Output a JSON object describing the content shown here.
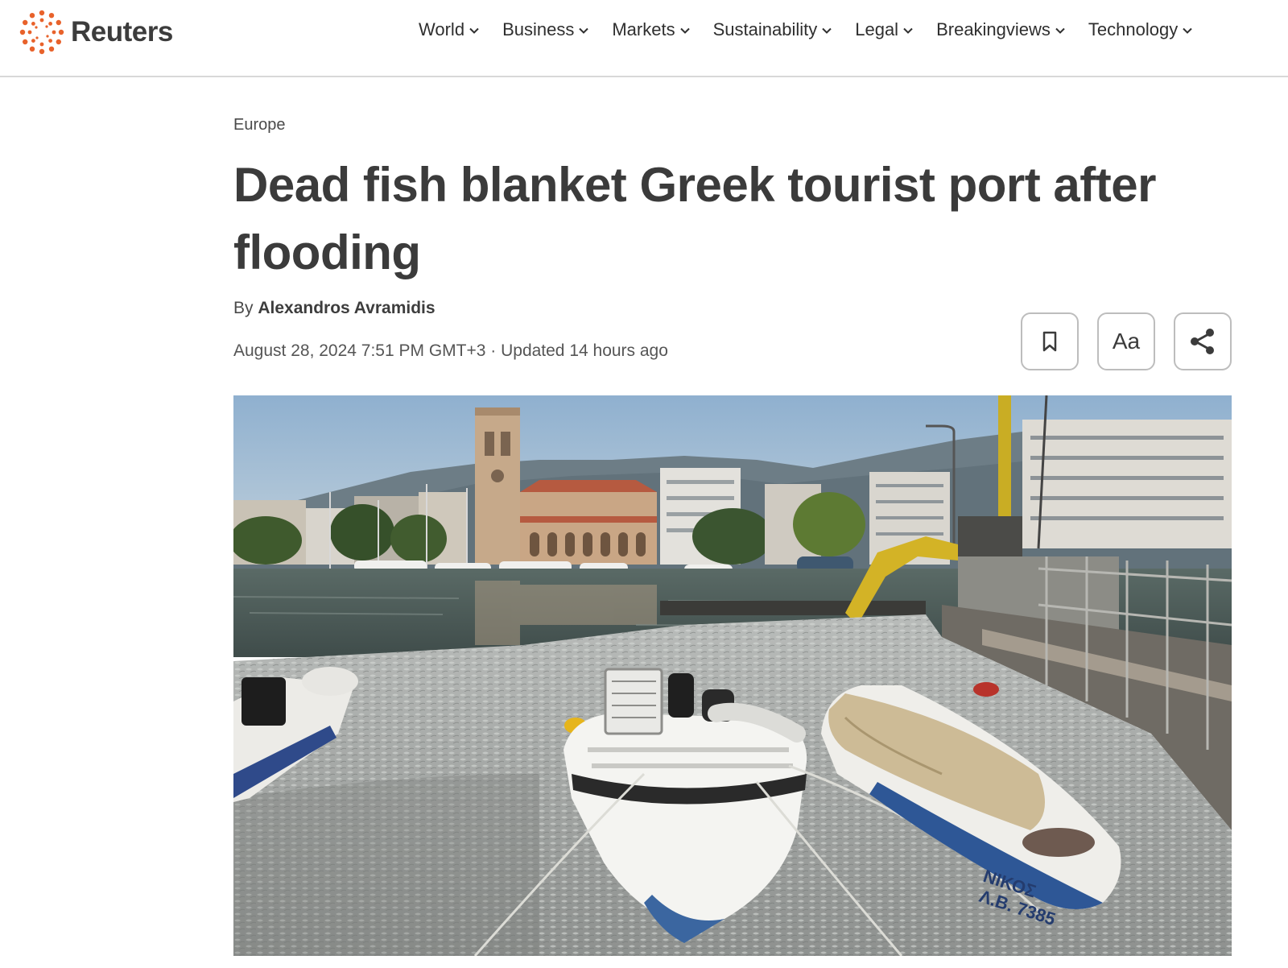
{
  "header": {
    "brand": "Reuters",
    "nav": [
      {
        "label": "World",
        "icon": "chevron-down-icon"
      },
      {
        "label": "Business",
        "icon": "chevron-down-icon"
      },
      {
        "label": "Markets",
        "icon": "chevron-down-icon"
      },
      {
        "label": "Sustainability",
        "icon": "chevron-down-icon"
      },
      {
        "label": "Legal",
        "icon": "chevron-down-icon"
      },
      {
        "label": "Breakingviews",
        "icon": "chevron-down-icon"
      },
      {
        "label": "Technology",
        "icon": "chevron-down-icon"
      }
    ]
  },
  "article": {
    "section": "Europe",
    "headline": "Dead fish blanket Greek tourist port after flooding",
    "byline_prefix": "By",
    "author": "Alexandros Avramidis",
    "dateline": "August 28, 2024 7:51 PM GMT+3 · Updated 14 hours ago",
    "tools": {
      "save_icon": "bookmark-icon",
      "text_size_label": "Aa",
      "share_icon": "share-icon"
    },
    "photo": {
      "boat_label_line1": "ΝΙΚΟΣ",
      "boat_label_line2": "Λ.Β. 7385"
    }
  },
  "colors": {
    "brand_orange": "#e8622b",
    "text_dark": "#3b3b3b",
    "divider": "#d8d8d8",
    "button_border": "#bdbdbd"
  }
}
